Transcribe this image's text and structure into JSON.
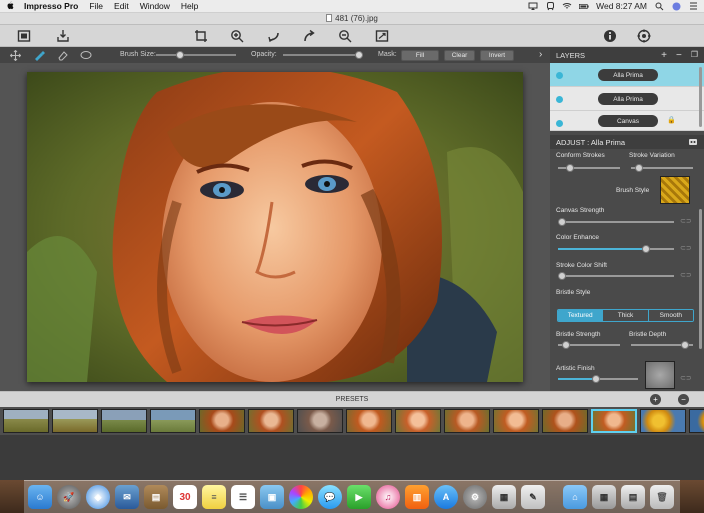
{
  "menubar": {
    "app_name": "Impresso Pro",
    "items": [
      "File",
      "Edit",
      "Window",
      "Help"
    ],
    "clock": "Wed 8:27 AM"
  },
  "window": {
    "title": "481 (76).jpg"
  },
  "subbar": {
    "brush_size_label": "Brush Size:",
    "opacity_label": "Opacity:",
    "mask_label": "Mask:",
    "fill_label": "Fill",
    "clear_label": "Clear",
    "invert_label": "Invert",
    "brush_size_value": 0.3,
    "opacity_value": 0.95
  },
  "layers": {
    "title": "LAYERS",
    "items": [
      {
        "name": "Alla Prima",
        "selected": true
      },
      {
        "name": "Alla Prima",
        "selected": false
      },
      {
        "name": "Canvas",
        "selected": false,
        "locked": true
      }
    ]
  },
  "adjust": {
    "title": "ADJUST : Alla Prima",
    "conform_strokes": "Conform Strokes",
    "stroke_variation": "Stroke Variation",
    "brush_style": "Brush Style",
    "canvas_strength": "Canvas Strength",
    "color_enhance": "Color Enhance",
    "stroke_color_shift": "Stroke Color Shift",
    "bristle_style": "Bristle Style",
    "bristle_options": [
      "Textured",
      "Thick",
      "Smooth"
    ],
    "bristle_selected": "Textured",
    "bristle_strength": "Bristle Strength",
    "bristle_depth": "Bristle Depth",
    "artistic_finish": "Artistic Finish",
    "values": {
      "conform_strokes": 0.15,
      "stroke_variation": 0.1,
      "canvas_strength": 0.04,
      "color_enhance": 0.75,
      "stroke_color_shift": 0.04,
      "bristle_strength": 0.1,
      "bristle_depth": 0.85,
      "artistic_finish": 0.45
    }
  },
  "presets": {
    "title": "PRESETS",
    "add": "+",
    "remove": "−"
  },
  "colors": {
    "accent": "#3fa6cc",
    "selected_layer": "#8fd6e6"
  }
}
